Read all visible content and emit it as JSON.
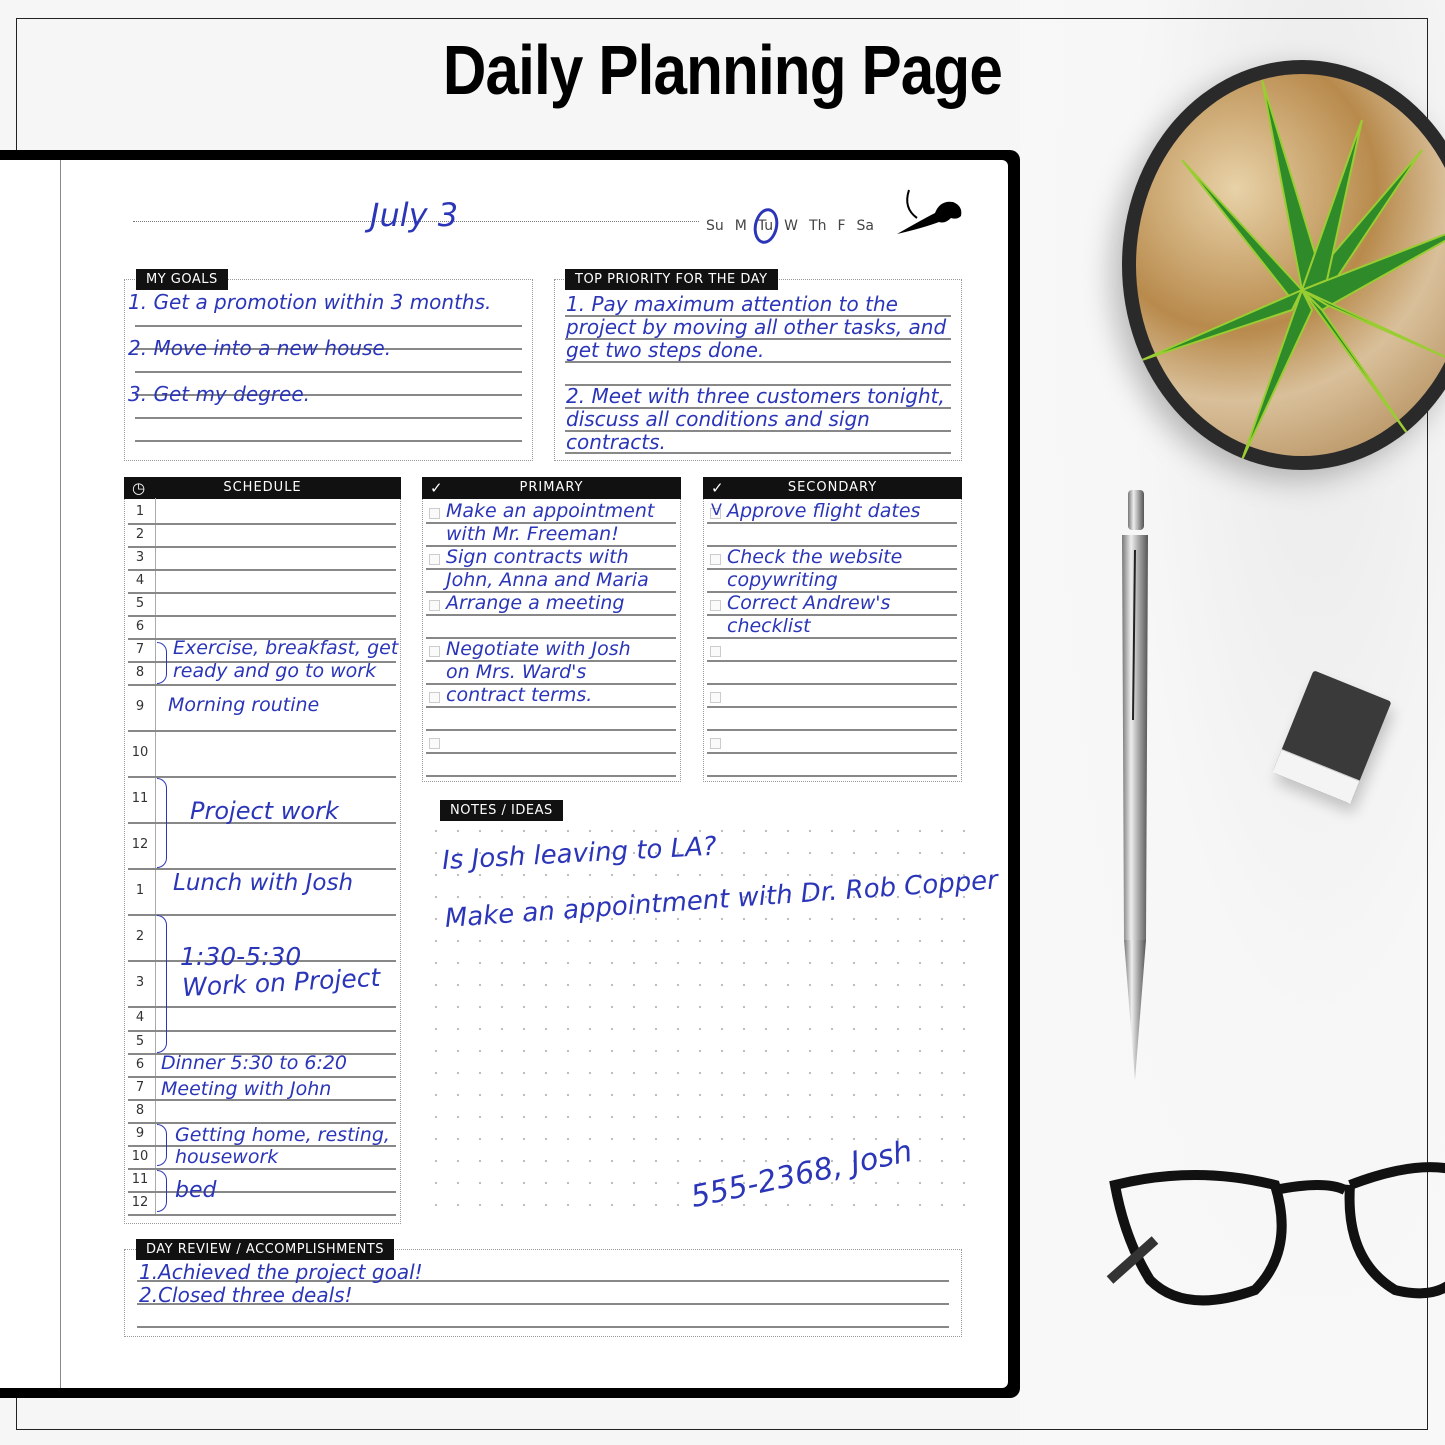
{
  "title": "Daily Planning Page",
  "header": {
    "date": "July 3",
    "weekdays": [
      "Su",
      "M",
      "Tu",
      "W",
      "Th",
      "F",
      "Sa"
    ],
    "selected_weekday": "Tu",
    "logo_icon": "lion-icon"
  },
  "goals": {
    "label": "MY GOALS",
    "items": [
      "1. Get a promotion within 3 months.",
      "2. Move into a new house.",
      "3. Get my degree."
    ]
  },
  "top_priority": {
    "label": "TOP PRIORITY FOR THE DAY",
    "lines": [
      "1. Pay maximum attention to the",
      "project by moving all other tasks, and",
      "get two steps done.",
      "2. Meet with three customers tonight,",
      "discuss all conditions and sign",
      "contracts."
    ]
  },
  "schedule": {
    "label": "SCHEDULE",
    "icon": "clock-icon",
    "hours": [
      "1",
      "2",
      "3",
      "4",
      "5",
      "6",
      "7",
      "8",
      "9",
      "10",
      "11",
      "12",
      "1",
      "2",
      "3",
      "4",
      "5",
      "6",
      "7",
      "8",
      "9",
      "10",
      "11",
      "12"
    ],
    "entries": [
      {
        "hours": "7-8",
        "lines": [
          "Exercise, breakfast, get",
          "ready and go to work"
        ]
      },
      {
        "hours": "9",
        "lines": [
          "Morning routine"
        ]
      },
      {
        "hours": "11-12",
        "lines": [
          "Project work"
        ]
      },
      {
        "hours": "1",
        "lines": [
          "Lunch with Josh"
        ]
      },
      {
        "hours": "2-5",
        "lines": [
          "1:30-5:30",
          "Work on Project"
        ]
      },
      {
        "hours": "6",
        "lines": [
          "Dinner 5:30 to 6:20"
        ]
      },
      {
        "hours": "7",
        "lines": [
          "Meeting with John"
        ]
      },
      {
        "hours": "9-10",
        "lines": [
          "Getting home, resting,",
          "housework"
        ]
      },
      {
        "hours": "11-12",
        "lines": [
          "bed"
        ]
      }
    ]
  },
  "primary": {
    "label": "PRIMARY",
    "icon": "checkmark-icon",
    "lines": [
      "Make an appointment",
      "with Mr. Freeman!",
      "Sign contracts with",
      "John, Anna and Maria",
      "Arrange a meeting",
      "",
      "Negotiate with Josh",
      "on Mrs. Ward's",
      "contract terms."
    ]
  },
  "secondary": {
    "label": "SECONDARY",
    "icon": "checkmark-icon",
    "done_mark": "V",
    "lines": [
      "Approve flight dates",
      "",
      "Check the website",
      "copywriting",
      "Correct Andrew's",
      "checklist"
    ]
  },
  "notes": {
    "label": "NOTES / IDEAS",
    "lines": [
      "Is Josh leaving to LA?",
      "Make an appointment with Dr. Rob Copper"
    ],
    "contact": "555-2368, Josh"
  },
  "day_review": {
    "label": "DAY REVIEW / ACCOMPLISHMENTS",
    "lines": [
      "1.Achieved the project goal!",
      "2.Closed three deals!"
    ]
  },
  "colors": {
    "ink": "#2b35b8",
    "label_bg": "#111111",
    "rule": "#888888"
  }
}
